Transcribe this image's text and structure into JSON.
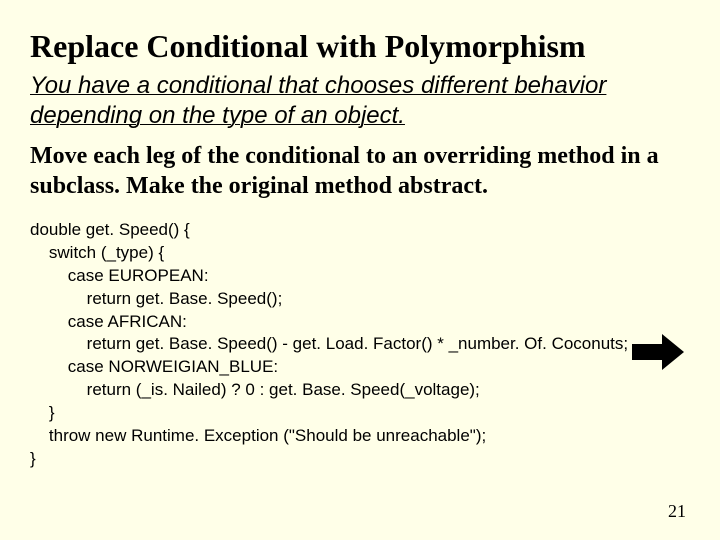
{
  "title": "Replace Conditional with Polymorphism",
  "problem": "You have a conditional that chooses different behavior depending on the type of an object.",
  "solution": "Move each leg of the conditional to an overriding method in a subclass. Make the original method abstract.",
  "code": "double get. Speed() {\n    switch (_type) {\n        case EUROPEAN:\n            return get. Base. Speed();\n        case AFRICAN:\n            return get. Base. Speed() - get. Load. Factor() * _number. Of. Coconuts;\n        case NORWEIGIAN_BLUE:\n            return (_is. Nailed) ? 0 : get. Base. Speed(_voltage);\n    }\n    throw new Runtime. Exception (\"Should be unreachable\");\n}",
  "page_number": "21"
}
